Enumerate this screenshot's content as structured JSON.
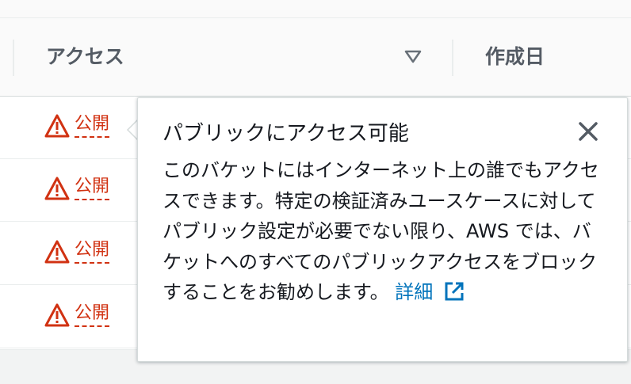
{
  "table": {
    "columns": {
      "access": "アクセス",
      "created": "作成日"
    },
    "rows": [
      {
        "access": "公開"
      },
      {
        "access": "公開"
      },
      {
        "access": "公開"
      },
      {
        "access": "公開"
      }
    ]
  },
  "popover": {
    "title": "パブリックにアクセス可能",
    "body": "このバケットにはインターネット上の誰でもアクセスできます。特定の検証済みユースケースに対してパブリック設定が必要でない限り、AWS では、バケットへのすべてのパブリックアクセスをブロックすることをお勧めします。",
    "link_label": "詳細"
  },
  "colors": {
    "warning": "#d13212",
    "link": "#0073bb",
    "header_text": "#545b64"
  },
  "icons": {
    "warning": "warning-triangle-icon",
    "sort": "sort-caret-down-icon",
    "close": "close-icon",
    "external": "external-link-icon"
  }
}
